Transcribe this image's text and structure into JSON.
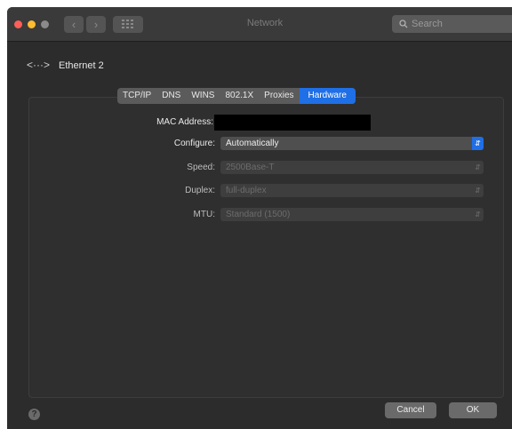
{
  "window": {
    "title": "Network"
  },
  "search": {
    "placeholder": "Search"
  },
  "interface": {
    "icon": "ethernet-icon",
    "name": "Ethernet 2"
  },
  "tabs": [
    {
      "label": "TCP/IP",
      "active": false
    },
    {
      "label": "DNS",
      "active": false
    },
    {
      "label": "WINS",
      "active": false
    },
    {
      "label": "802.1X",
      "active": false
    },
    {
      "label": "Proxies",
      "active": false
    },
    {
      "label": "Hardware",
      "active": true
    }
  ],
  "hardware": {
    "mac_label": "MAC Address:",
    "configure_label": "Configure:",
    "configure_value": "Automatically",
    "speed_label": "Speed:",
    "speed_value": "2500Base-T",
    "duplex_label": "Duplex:",
    "duplex_value": "full-duplex",
    "mtu_label": "MTU:",
    "mtu_value": "Standard (1500)"
  },
  "footer": {
    "help": "?",
    "cancel": "Cancel",
    "ok": "OK"
  },
  "colors": {
    "accent": "#1f6fe6",
    "close": "#ff5f57",
    "minimize": "#febc2e",
    "zoom": "#8a8a8a"
  }
}
